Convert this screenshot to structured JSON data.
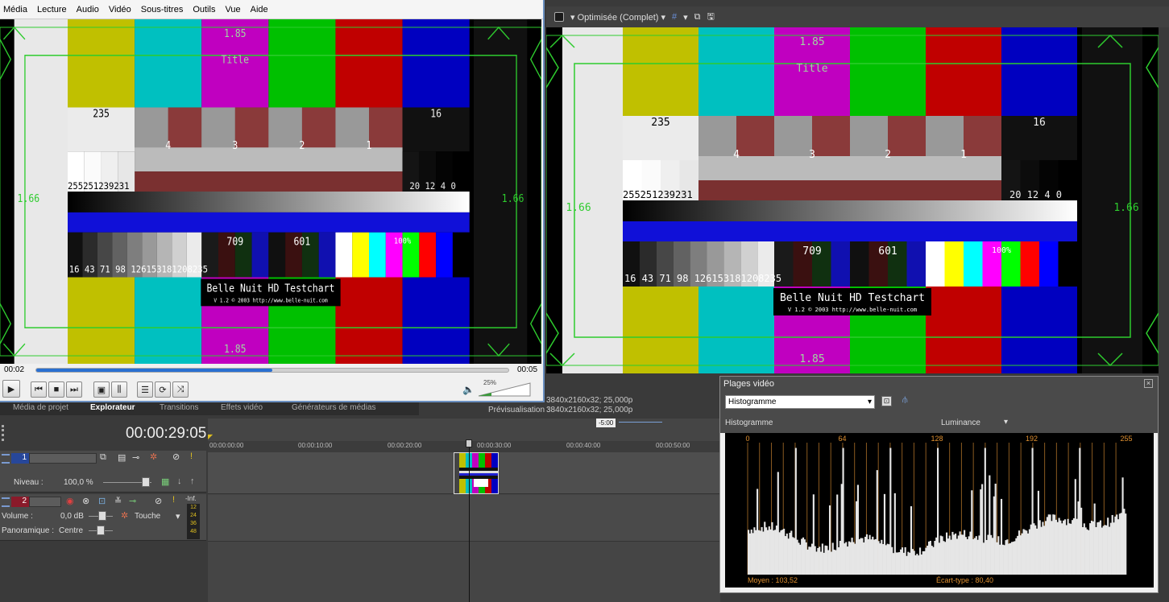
{
  "vlc": {
    "menu": [
      "Média",
      "Lecture",
      "Audio",
      "Vidéo",
      "Sous-titres",
      "Outils",
      "Vue",
      "Aide"
    ],
    "time_current": "00:02",
    "time_total": "00:05",
    "seek_progress": 0.5,
    "volume_label": "25%",
    "volume_level": 0.25
  },
  "testchart": {
    "label_185": "1.85",
    "label_title": "Title",
    "label_166": "1.66",
    "label_235": "235",
    "label_16": "16",
    "left_values": "255251239231",
    "right_values": "20 12 4  0",
    "steps_low": "16 43 71 98 126153181208235",
    "label_709": "709",
    "label_601": "601",
    "label_100": "100%",
    "res_4": "4",
    "res_3": "3",
    "res_2": "2",
    "res_1": "1",
    "name": "Belle Nuit HD Testchart",
    "version": "V 1.2 © 2003 http://www.belle-nuit.com"
  },
  "preview": {
    "quality": "Optimisée (Complet)",
    "project_line": "3840x2160x32; 25,000p",
    "preview_label": "Prévisualisation :",
    "preview_line": "3840x2160x32; 25,000p"
  },
  "tabs": [
    "Média de projet",
    "Explorateur",
    "Transitions",
    "Effets vidéo",
    "Générateurs de médias"
  ],
  "timeline": {
    "timecode": "00:00:29:05",
    "marker": "-5:00",
    "ticks": [
      "00:00:00:00",
      "00:00:10:00",
      "00:00:20:00",
      "00:00:30:00",
      "00:00:40:00",
      "00:00:50:00"
    ],
    "track1": {
      "number": "1",
      "level_label": "Niveau :",
      "level_value": "100,0 %"
    },
    "track2": {
      "number": "2",
      "volume_label": "Volume :",
      "volume_value": "0,0 dB",
      "mode": "Touche",
      "pan_label": "Panoramique :",
      "pan_value": "Centre",
      "meter_top": "-Inf.",
      "meter_ticks": [
        "12",
        "24",
        "36",
        "48"
      ]
    }
  },
  "scopes": {
    "title": "Plages vidéo",
    "mode": "Histogramme",
    "sub_left": "Histogramme",
    "channel": "Luminance",
    "axis": [
      "0",
      "64",
      "128",
      "192",
      "255"
    ],
    "mean": "Moyen : 103,52",
    "stddev": "Écart-type : 80,40"
  },
  "colors": {
    "bar_yellow": "#c0c000",
    "bar_cyan": "#00c0c0",
    "bar_magenta": "#c000c0",
    "bar_green": "#00c000",
    "bar_red": "#c00000",
    "bar_blue": "#0000c0",
    "guide_green": "#2ecc2e",
    "accent_orange": "#e09030"
  }
}
